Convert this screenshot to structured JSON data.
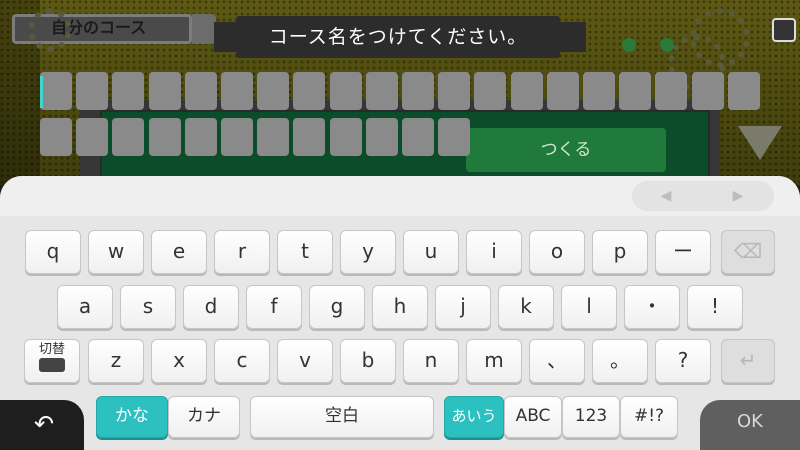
{
  "background": {
    "course_tab_label": "自分のコース",
    "title": "コース名をつけてください。",
    "create_button": "つくる"
  },
  "name_input": {
    "value": "",
    "box_count": 32
  },
  "keyboard": {
    "nav_prev_icon": "triangle-left-icon",
    "nav_next_icon": "triangle-right-icon",
    "row1": [
      "q",
      "w",
      "e",
      "r",
      "t",
      "y",
      "u",
      "i",
      "o",
      "p",
      "ー"
    ],
    "backspace_icon": "backspace-icon",
    "row2": [
      "a",
      "s",
      "d",
      "f",
      "g",
      "h",
      "j",
      "k",
      "l",
      "・",
      "!"
    ],
    "switch_label": "切替",
    "switch_icon": "keyboard-icon",
    "row3": [
      "z",
      "x",
      "c",
      "v",
      "b",
      "n",
      "m",
      "、",
      "。",
      "?"
    ],
    "enter_icon": "enter-icon",
    "kana_mode": {
      "hiragana": "かな",
      "katakana": "カナ"
    },
    "space_label": "空白",
    "input_modes": {
      "hiragana": "あいう",
      "alpha": "ABC",
      "numeric": "123",
      "symbols": "#!?"
    },
    "back_icon": "back-arrow-icon",
    "ok_label": "OK"
  },
  "colors": {
    "accent": "#2cc0c0",
    "key_face": "#ffffff",
    "input_box": "#8a8a8a"
  }
}
